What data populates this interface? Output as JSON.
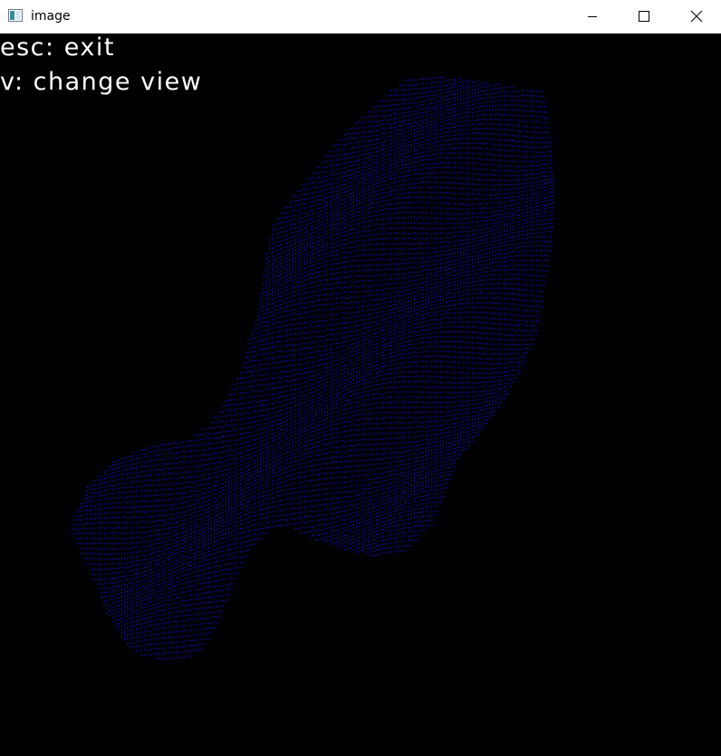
{
  "window": {
    "title": "image",
    "controls": {
      "minimize": "minimize-icon",
      "maximize": "maximize-icon",
      "close": "close-icon"
    }
  },
  "overlay": {
    "lines": [
      "esc: exit",
      "v: change view"
    ],
    "text_color": "#ffffff"
  },
  "canvas": {
    "background": "#000000",
    "point_color": "#1e1eff",
    "content": "point-cloud"
  }
}
